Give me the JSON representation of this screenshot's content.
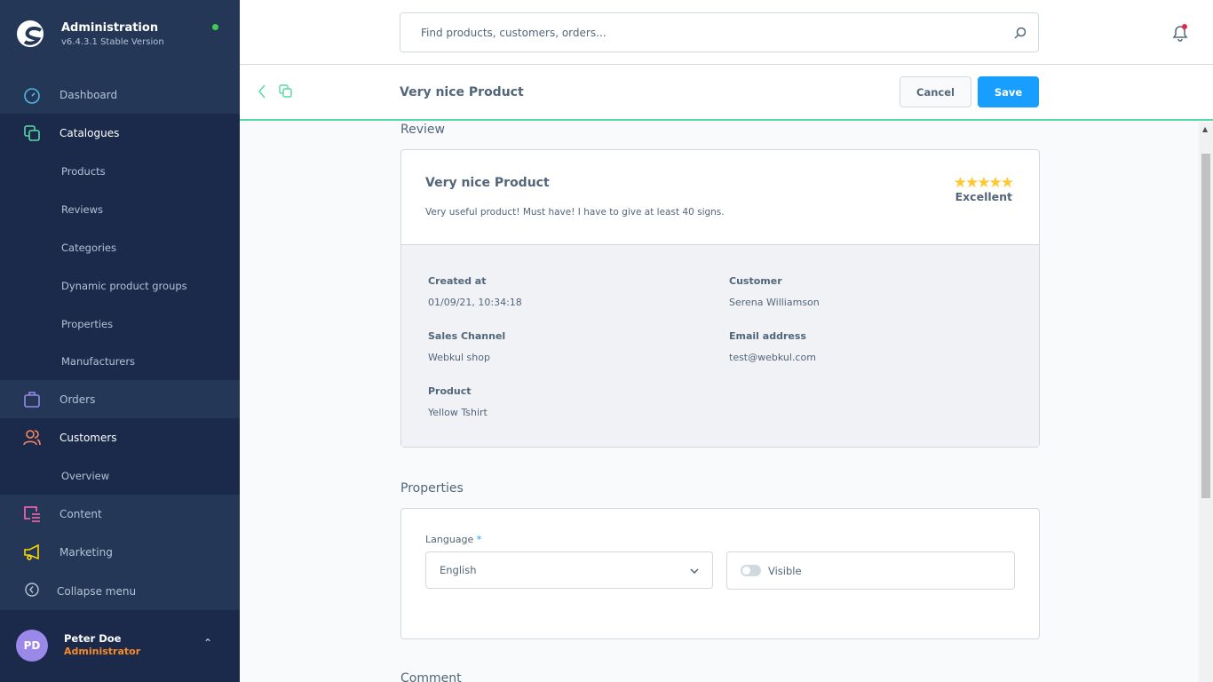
{
  "app": {
    "title": "Administration",
    "version": "v6.4.3.1 Stable Version",
    "status_color": "#3fcf4f"
  },
  "sidebar": {
    "items": [
      {
        "label": "Dashboard",
        "icon": "gauge-icon",
        "color": "#4fb9e4"
      },
      {
        "label": "Catalogues",
        "icon": "catalogue-icon",
        "color": "#57d9a3",
        "children": [
          "Products",
          "Reviews",
          "Categories",
          "Dynamic product groups",
          "Properties",
          "Manufacturers"
        ]
      },
      {
        "label": "Orders",
        "icon": "shopping-bag-icon",
        "color": "#9a89e8"
      },
      {
        "label": "Customers",
        "icon": "users-icon",
        "color": "#f8895e",
        "children": [
          "Overview"
        ]
      },
      {
        "label": "Content",
        "icon": "content-icon",
        "color": "#ff68b4"
      },
      {
        "label": "Marketing",
        "icon": "megaphone-icon",
        "color": "#ffd700"
      }
    ],
    "collapse_label": "Collapse menu",
    "user": {
      "initials": "PD",
      "name": "Peter Doe",
      "role": "Administrator"
    }
  },
  "search": {
    "placeholder": "Find products, customers, orders..."
  },
  "smartbar": {
    "title": "Very nice Product",
    "cancel": "Cancel",
    "save": "Save"
  },
  "review": {
    "section_title": "Review",
    "title": "Very nice Product",
    "content": "Very useful product! Must have! I have to give at least 40 signs.",
    "rating": 5,
    "rating_max": 5,
    "rating_label": "Excellent",
    "fields": {
      "created_at": {
        "label": "Created at",
        "value": "01/09/21, 10:34:18"
      },
      "customer": {
        "label": "Customer",
        "value": "Serena Williamson"
      },
      "sales_channel": {
        "label": "Sales Channel",
        "value": "Webkul shop"
      },
      "email": {
        "label": "Email address",
        "value": "test@webkul.com"
      },
      "product": {
        "label": "Product",
        "value": "Yellow Tshirt"
      }
    }
  },
  "properties": {
    "section_title": "Properties",
    "language_label": "Language",
    "required_mark": "*",
    "language_value": "English",
    "visible_label": "Visible",
    "visible": false
  },
  "comment": {
    "section_title": "Comment"
  }
}
